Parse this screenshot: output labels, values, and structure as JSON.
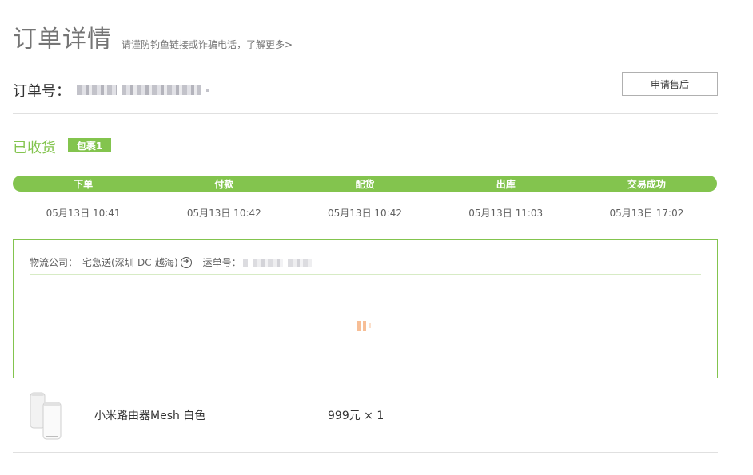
{
  "header": {
    "title": "订单详情",
    "warning_link": "请谨防钓鱼链接或诈骗电话，了解更多>",
    "order_label": "订单号：",
    "after_sales_button": "申请售后"
  },
  "status": {
    "label": "已收货",
    "package_badge": "包裹1"
  },
  "progress": {
    "steps": [
      "下单",
      "付款",
      "配货",
      "出库",
      "交易成功"
    ],
    "times": [
      "05月13日 10:41",
      "05月13日 10:42",
      "05月13日 10:42",
      "05月13日 11:03",
      "05月13日 17:02"
    ]
  },
  "logistics": {
    "company_label": "物流公司：",
    "company_name": "宅急送(深圳-DC-越海)",
    "tracking_label": "运单号："
  },
  "product": {
    "name": "小米路由器Mesh 白色",
    "price_qty": "999元 × 1"
  },
  "colors": {
    "accent": "#83c44e",
    "title_gray": "#757575",
    "divider": "#e0e0e0"
  },
  "icons": [
    "circle-arrow-right-icon",
    "loading-icon",
    "router-product-image"
  ]
}
